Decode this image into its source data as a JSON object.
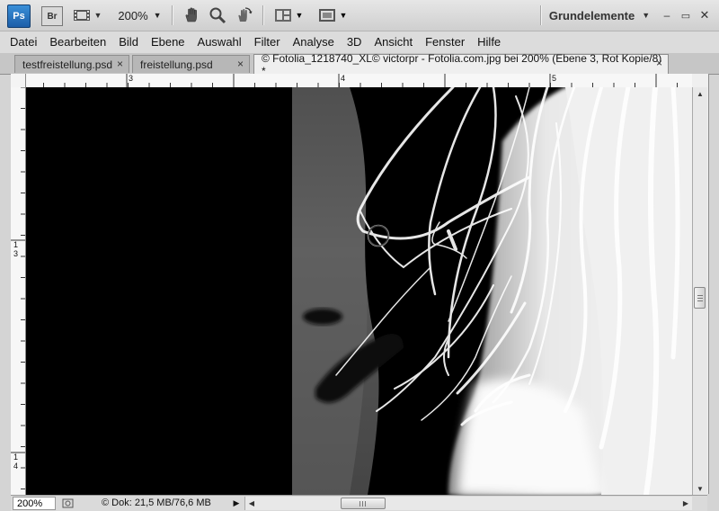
{
  "app": {
    "logo": "Ps",
    "bridge_logo": "Br",
    "zoom_level": "200%",
    "workspace": "Grundelemente",
    "icons": {
      "screen_mode": "film-strip-icon",
      "hand": "hand-icon",
      "zoom": "magnifier-icon",
      "rotate": "rotate-view-icon",
      "arrange": "arrange-documents-icon",
      "screen_mode2": "screen-mode-icon"
    }
  },
  "window_controls": {
    "minimize": "–",
    "maximize": "▭",
    "close": "✕"
  },
  "menu": [
    "Datei",
    "Bearbeiten",
    "Bild",
    "Ebene",
    "Auswahl",
    "Filter",
    "Analyse",
    "3D",
    "Ansicht",
    "Fenster",
    "Hilfe"
  ],
  "tabs": [
    {
      "label": "testfreistellung.psd",
      "active": false
    },
    {
      "label": "freistellung.psd",
      "active": false
    },
    {
      "label": "© Fotolia_1218740_XL© victorpr - Fotolia.com.jpg bei 200% (Ebene 3, Rot Kopie/8) *",
      "active": true
    }
  ],
  "tab_close": "×",
  "rulers": {
    "horizontal_labels": [
      "3",
      "4",
      "5"
    ],
    "vertical_labels": [
      "1",
      "3",
      "1",
      "4"
    ]
  },
  "status": {
    "zoom": "200%",
    "doc_info": "© Dok: 21,5 MB/76,6 MB"
  },
  "colors": {
    "ps_blue": "#2a74c0",
    "canvas_black": "#000000",
    "hair_white": "#ffffff"
  }
}
